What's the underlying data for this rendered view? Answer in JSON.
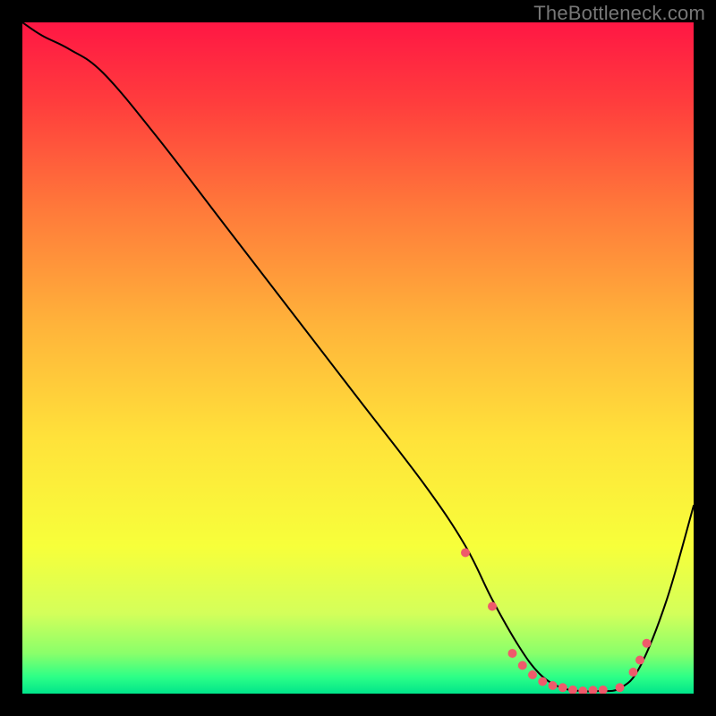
{
  "watermark": "TheBottleneck.com",
  "chart_data": {
    "type": "line",
    "title": "",
    "xlabel": "",
    "ylabel": "",
    "xlim": [
      0,
      100
    ],
    "ylim": [
      0,
      100
    ],
    "gradient_stops": [
      {
        "offset": 0.0,
        "color": "#ff1744"
      },
      {
        "offset": 0.12,
        "color": "#ff3d3d"
      },
      {
        "offset": 0.28,
        "color": "#ff7a3a"
      },
      {
        "offset": 0.45,
        "color": "#ffb33a"
      },
      {
        "offset": 0.62,
        "color": "#ffe23a"
      },
      {
        "offset": 0.78,
        "color": "#f7ff3a"
      },
      {
        "offset": 0.88,
        "color": "#d4ff5a"
      },
      {
        "offset": 0.94,
        "color": "#8aff6a"
      },
      {
        "offset": 0.975,
        "color": "#2dff87"
      },
      {
        "offset": 1.0,
        "color": "#00e58a"
      }
    ],
    "series": [
      {
        "name": "bottleneck-curve",
        "stroke": "#000000",
        "stroke_width": 2,
        "x": [
          0,
          3,
          7,
          12,
          20,
          30,
          40,
          50,
          60,
          66,
          70,
          74,
          77,
          80,
          83,
          86,
          89,
          92,
          96,
          100
        ],
        "values": [
          100,
          98,
          96,
          92.5,
          83,
          70,
          57,
          44,
          31,
          22,
          14,
          7,
          3,
          1,
          0.4,
          0.4,
          0.8,
          4,
          14,
          28
        ]
      }
    ],
    "markers": {
      "color": "#ef5a6b",
      "radius": 5,
      "x": [
        66,
        70,
        73,
        74.5,
        76,
        77.5,
        79,
        80.5,
        82,
        83.5,
        85,
        86.5,
        89,
        91,
        92,
        93
      ],
      "values": [
        21,
        13,
        6,
        4.2,
        2.8,
        1.8,
        1.2,
        0.9,
        0.55,
        0.4,
        0.5,
        0.55,
        0.9,
        3.2,
        5.0,
        7.5
      ]
    }
  }
}
